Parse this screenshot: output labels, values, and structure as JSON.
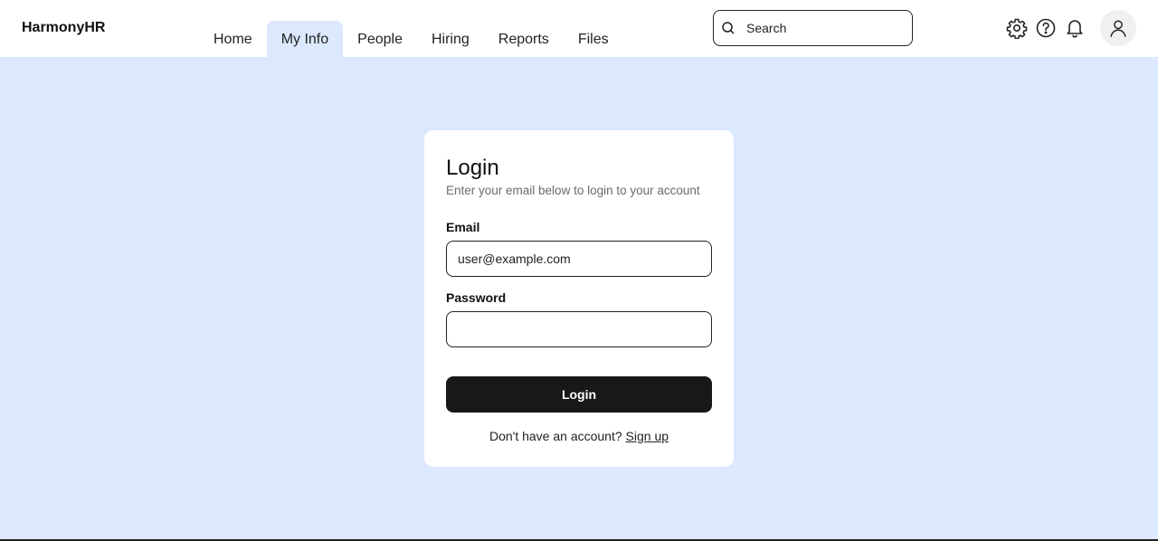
{
  "app": {
    "brand": "HarmonyHR"
  },
  "nav": {
    "tabs": [
      {
        "label": "Home",
        "active": false
      },
      {
        "label": "My Info",
        "active": true
      },
      {
        "label": "People",
        "active": false
      },
      {
        "label": "Hiring",
        "active": false
      },
      {
        "label": "Reports",
        "active": false
      },
      {
        "label": "Files",
        "active": false
      }
    ]
  },
  "search": {
    "placeholder": "Search",
    "icon": "search-icon"
  },
  "toolbar": {
    "icons": [
      "gear-icon",
      "help-icon",
      "bell-icon",
      "user-icon"
    ]
  },
  "login": {
    "title": "Login",
    "subtitle": "Enter your email below to login to your account",
    "email_label": "Email",
    "email_value": "user@example.com",
    "password_label": "Password",
    "password_value": "",
    "button_label": "Login",
    "signup_prompt": "Don't have an account?",
    "signup_link": "Sign up"
  },
  "colors": {
    "background": "#dbe8fd",
    "active_tab": "#dbe8fd",
    "button": "#18181b",
    "subtitle": "#6b6b6b"
  }
}
